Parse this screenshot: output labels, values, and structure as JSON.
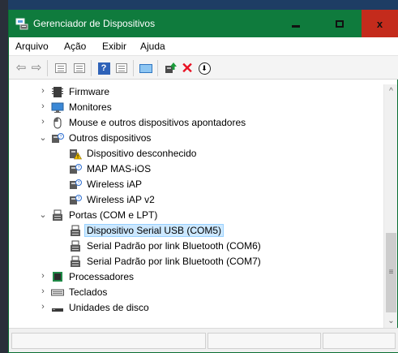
{
  "window": {
    "title": "Gerenciador de Dispositivos",
    "close_symbol": "x",
    "titlebar_color": "#0f7b3d",
    "close_color": "#c42b1c"
  },
  "menu": [
    "Arquivo",
    "Ação",
    "Exibir",
    "Ajuda"
  ],
  "toolbar": [
    {
      "icon": "back-arrow-icon",
      "glyph": "⇦"
    },
    {
      "icon": "forward-arrow-icon",
      "glyph": "⇨"
    },
    {
      "icon": "properties-icon"
    },
    {
      "icon": "show-hide-icon"
    },
    {
      "icon": "help-icon",
      "glyph": "?"
    },
    {
      "icon": "view-icon"
    },
    {
      "icon": "scan-hardware-icon"
    },
    {
      "icon": "update-driver-icon"
    },
    {
      "icon": "uninstall-icon",
      "glyph": "✕"
    },
    {
      "icon": "disable-icon",
      "glyph": "⬇"
    }
  ],
  "tree": [
    {
      "label": "Firmware",
      "level": 0,
      "expanded": false,
      "icon": "firmware-icon"
    },
    {
      "label": "Monitores",
      "level": 0,
      "expanded": false,
      "icon": "monitor-icon"
    },
    {
      "label": "Mouse e outros dispositivos apontadores",
      "level": 0,
      "expanded": false,
      "icon": "mouse-icon"
    },
    {
      "label": "Outros dispositivos",
      "level": 0,
      "expanded": true,
      "icon": "unknown-device-icon"
    },
    {
      "label": "Dispositivo desconhecido",
      "level": 1,
      "icon": "warning-device-icon"
    },
    {
      "label": "MAP MAS-iOS",
      "level": 1,
      "icon": "unknown-device-icon"
    },
    {
      "label": "Wireless iAP",
      "level": 1,
      "icon": "unknown-device-icon"
    },
    {
      "label": "Wireless iAP v2",
      "level": 1,
      "icon": "unknown-device-icon"
    },
    {
      "label": "Portas (COM e LPT)",
      "level": 0,
      "expanded": true,
      "icon": "port-icon"
    },
    {
      "label": "Dispositivo Serial USB (COM5)",
      "level": 1,
      "icon": "port-icon",
      "selected": true
    },
    {
      "label": "Serial Padrão por link Bluetooth (COM6)",
      "level": 1,
      "icon": "port-icon"
    },
    {
      "label": "Serial Padrão por link Bluetooth (COM7)",
      "level": 1,
      "icon": "port-icon"
    },
    {
      "label": "Processadores",
      "level": 0,
      "expanded": false,
      "icon": "processor-icon"
    },
    {
      "label": "Teclados",
      "level": 0,
      "expanded": false,
      "icon": "keyboard-icon"
    },
    {
      "label": "Unidades de disco",
      "level": 0,
      "expanded": false,
      "icon": "disk-icon"
    }
  ],
  "colors": {
    "selection": "#cce8ff",
    "selection_border": "#99d1ff"
  }
}
